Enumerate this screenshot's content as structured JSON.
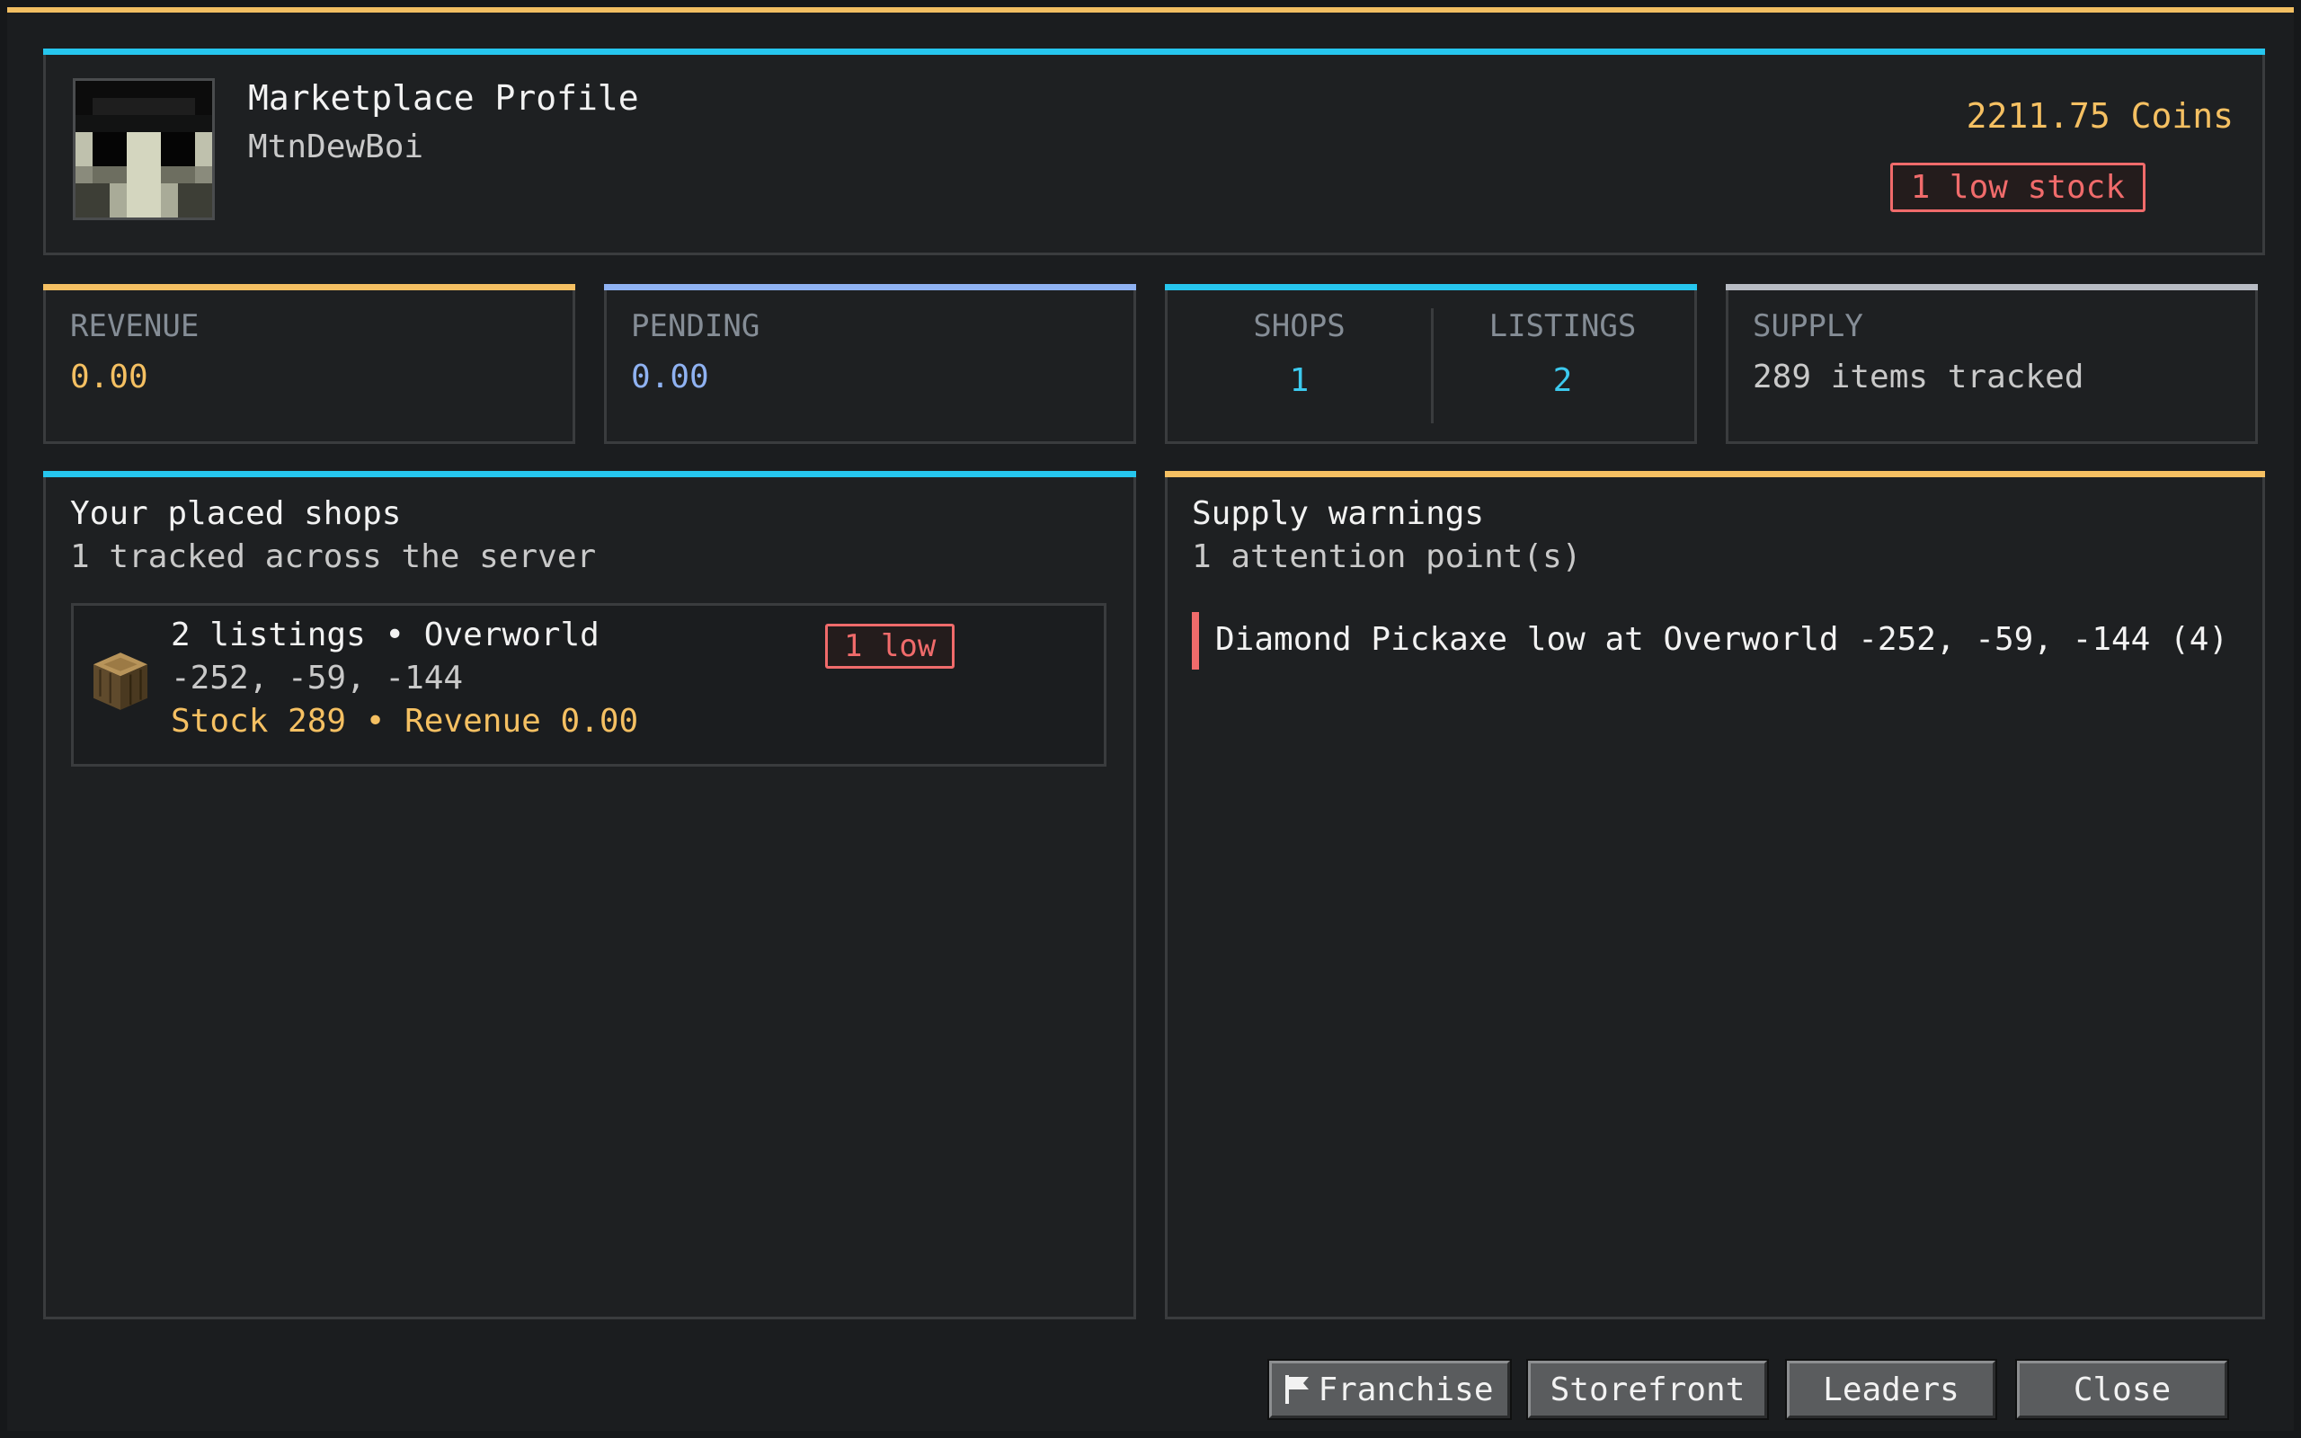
{
  "header": {
    "title": "Marketplace Profile",
    "username": "MtnDewBoi",
    "coins": "2211.75 Coins",
    "low_stock": "1 low stock"
  },
  "stats": {
    "revenue": {
      "label": "REVENUE",
      "value": "0.00"
    },
    "pending": {
      "label": "PENDING",
      "value": "0.00"
    },
    "shops": {
      "label": "SHOPS",
      "value": "1"
    },
    "listings": {
      "label": "LISTINGS",
      "value": "2"
    },
    "supply": {
      "label": "SUPPLY",
      "value": "289 items tracked"
    }
  },
  "shops_panel": {
    "title": "Your placed shops",
    "subtitle": "1 tracked across the server",
    "shops": [
      {
        "line1": "2 listings • Overworld",
        "coords": "-252, -59, -144",
        "line3": "Stock 289 • Revenue 0.00",
        "badge": "1 low",
        "icon": "oak-log-icon"
      }
    ]
  },
  "warnings_panel": {
    "title": "Supply warnings",
    "subtitle": "1 attention point(s)",
    "warnings": [
      "Diamond Pickaxe low at Overworld -252, -59, -144 (4)"
    ]
  },
  "buttons": {
    "franchise": "Franchise",
    "storefront": "Storefront",
    "leaders": "Leaders",
    "close": "Close"
  },
  "colors": {
    "gold": "#f5c062",
    "blue": "#8fb2f2",
    "cyan": "#3cc9ee",
    "gray": "#b8bcc4",
    "red": "#f06b6b"
  }
}
